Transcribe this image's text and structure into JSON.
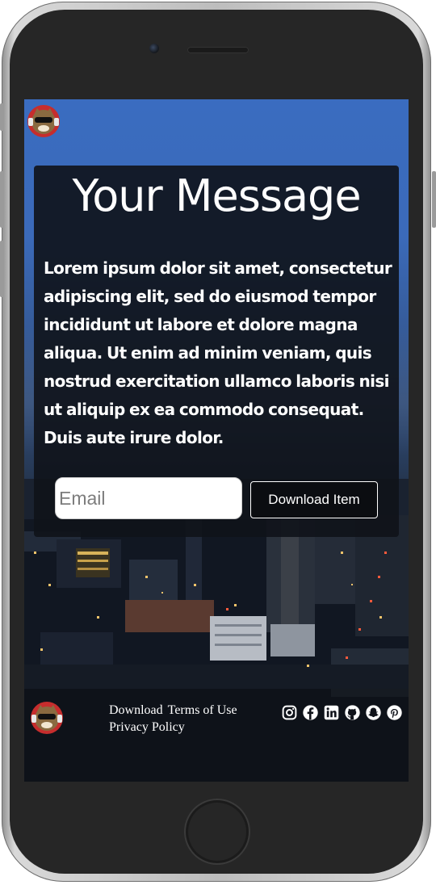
{
  "hero": {
    "title": "Your Message",
    "body": "Lorem ipsum dolor sit amet, consectetur adipiscing elit, sed do eiusmod tempor incididunt ut labore et dolore magna aliqua. Ut enim ad minim veniam, quis nostrud exercitation ullamco laboris nisi ut aliquip ex ea commodo consequat. Duis aute irure dolor."
  },
  "form": {
    "email_placeholder": "Email",
    "email_value": "",
    "button_label": "Download Item"
  },
  "footer": {
    "links": [
      "Download",
      "Terms of Use",
      "Privacy Policy"
    ],
    "social_icons": [
      "instagram-icon",
      "facebook-icon",
      "linkedin-icon",
      "github-icon",
      "snapchat-icon",
      "pinterest-icon"
    ]
  },
  "icons": {
    "brand_logo": "cat-headphones-logo"
  },
  "colors": {
    "panel": "#10131a",
    "text": "#ffffff",
    "sky": "#3a6cc0",
    "button_border": "#ffffff"
  }
}
